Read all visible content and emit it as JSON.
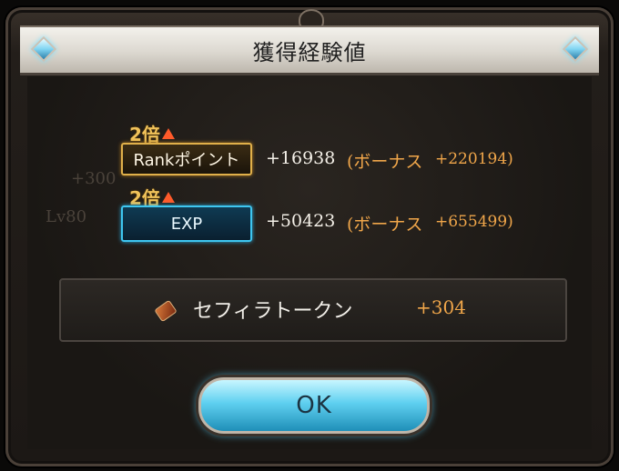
{
  "dialog": {
    "title": "獲得経験値"
  },
  "background": {
    "ghost_value": "+300",
    "ghost_level": "Lv80"
  },
  "rank": {
    "multiplier": "2倍",
    "label": "Rankポイント",
    "value": "+16938",
    "bonus_label": "(ボーナス",
    "bonus_value": "+220194)"
  },
  "exp": {
    "multiplier": "2倍",
    "label": "EXP",
    "value": "+50423",
    "bonus_label": "(ボーナス",
    "bonus_value": "+655499)"
  },
  "item": {
    "icon": "sephira-token-icon",
    "name": "セフィラトークン",
    "count": "+304"
  },
  "ok_button": {
    "label": "OK"
  },
  "colors": {
    "accent_gold": "#f0a64a",
    "rank_border": "#e0b04a",
    "exp_border": "#3ec6f0",
    "button_blue": "#5fd0f0"
  }
}
